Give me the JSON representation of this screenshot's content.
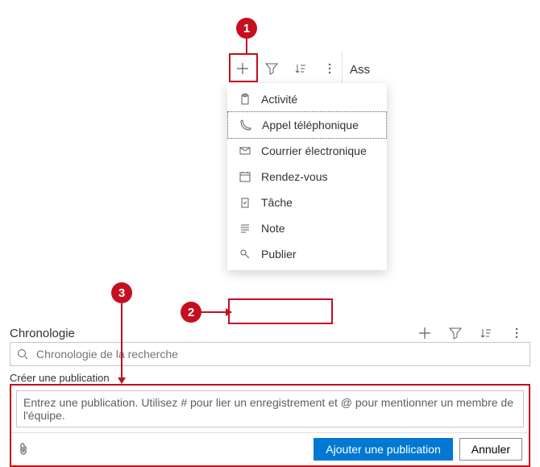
{
  "colors": {
    "accent": "#c50f1f",
    "primary": "#0078d4"
  },
  "callouts": {
    "c1": "1",
    "c2": "2",
    "c3": "3"
  },
  "toolbar": {
    "ass_label": "Ass"
  },
  "menu": {
    "items": [
      {
        "icon": "clipboard-icon",
        "label": "Activité"
      },
      {
        "icon": "phone-icon",
        "label": "Appel téléphonique"
      },
      {
        "icon": "mail-icon",
        "label": "Courrier électronique"
      },
      {
        "icon": "calendar-icon",
        "label": "Rendez-vous"
      },
      {
        "icon": "task-icon",
        "label": "Tâche"
      },
      {
        "icon": "note-icon",
        "label": "Note"
      },
      {
        "icon": "pin-icon",
        "label": "Publier"
      }
    ]
  },
  "chronologie": {
    "title": "Chronologie",
    "search_placeholder": "Chronologie de la recherche",
    "create_label": "Créer une publication",
    "textarea_placeholder": "Entrez une publication. Utilisez # pour lier un enregistrement et @ pour mentionner un membre de l'équipe.",
    "add_button": "Ajouter une publication",
    "cancel_button": "Annuler"
  }
}
